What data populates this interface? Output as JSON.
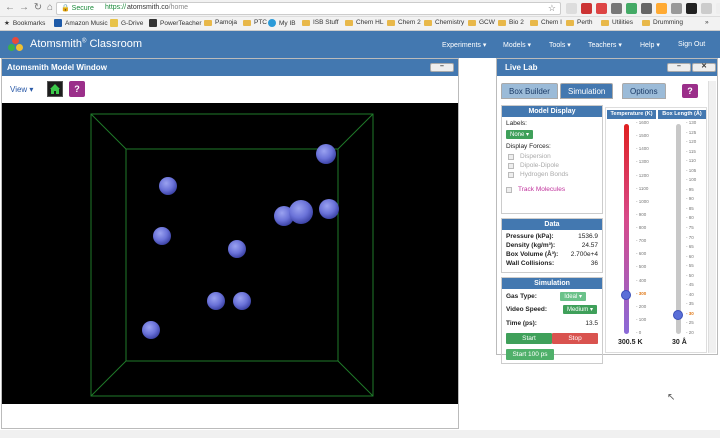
{
  "browser": {
    "secure_label": "Secure",
    "url_scheme": "https://",
    "url_host": "atomsmith.co",
    "url_path": "/home",
    "bookmarks": [
      "Bookmarks",
      "Amazon Music",
      "G-Drive",
      "PowerTeacher",
      "Pamoja",
      "PTC",
      "My IB",
      "ISB Stuff",
      "Chem HL",
      "Chem 2",
      "Chemistry",
      "GCW",
      "Bio 2",
      "Chem I",
      "Perth",
      "Utilities",
      "Drumming"
    ],
    "more_label": "»"
  },
  "app": {
    "brand": "Atomsmith",
    "brand_mark": "®",
    "brand_suffix": " Classroom",
    "menu": [
      "Experiments ▾",
      "Models ▾",
      "Tools ▾",
      "Teachers ▾",
      "Help ▾",
      "Sign Out"
    ]
  },
  "model_window": {
    "title": "Atomsmith Model Window",
    "view_label": "View ▾",
    "help_label": "?",
    "minimize_label": "–"
  },
  "live_lab": {
    "title": "Live Lab",
    "tabs": [
      "Box Builder",
      "Simulation",
      "Options"
    ],
    "active_tab": "Simulation",
    "help_label": "?",
    "model_display": {
      "title": "Model Display",
      "labels_label": "Labels:",
      "labels_value": "None ▾",
      "display_forces_label": "Display Forces:",
      "forces": [
        "Dispersion",
        "Dipole-Dipole",
        "Hydrogen Bonds"
      ],
      "track_label": "Track Molecules"
    },
    "data": {
      "title": "Data",
      "rows": [
        {
          "label": "Pressure (kPa):",
          "value": "1536.9"
        },
        {
          "label": "Density (kg/m³):",
          "value": "24.57"
        },
        {
          "label": "Box Volume (Å³):",
          "value": "2.700e+4"
        },
        {
          "label": "Wall Collisions:",
          "value": "36"
        }
      ]
    },
    "simulation": {
      "title": "Simulation",
      "gas_type_label": "Gas Type:",
      "gas_type_value": "Ideal ▾",
      "video_speed_label": "Video Speed:",
      "video_speed_value": "Medium ▾",
      "time_label": "Time (ps):",
      "time_value": "13.5",
      "start_label": "Start",
      "stop_label": "Stop",
      "start100_label": "Start 100 ps"
    },
    "temperature": {
      "header": "Temperature (K)",
      "ticks": [
        "1600",
        "1500",
        "1400",
        "1300",
        "1200",
        "1100",
        "1000",
        "900",
        "800",
        "700",
        "600",
        "500",
        "400",
        "300",
        "200",
        "100",
        "0"
      ],
      "value": "300.5 K",
      "level": 0.1878,
      "current_tick": "300"
    },
    "box_length": {
      "header": "Box Length (Å)",
      "ticks": [
        "130",
        "125",
        "120",
        "115",
        "110",
        "105",
        "100",
        "95",
        "90",
        "85",
        "80",
        "75",
        "70",
        "65",
        "60",
        "55",
        "50",
        "45",
        "40",
        "35",
        "30",
        "25",
        "20"
      ],
      "value": "30 Å",
      "level": 0.0909,
      "current_tick": "30"
    }
  },
  "colors": {
    "header_blue": "#4378b0",
    "atom": "#6a72d8",
    "box_edge": "#1f7a2a",
    "start": "#3fa05a",
    "stop": "#d9534f",
    "help": "#9b2f8a"
  }
}
